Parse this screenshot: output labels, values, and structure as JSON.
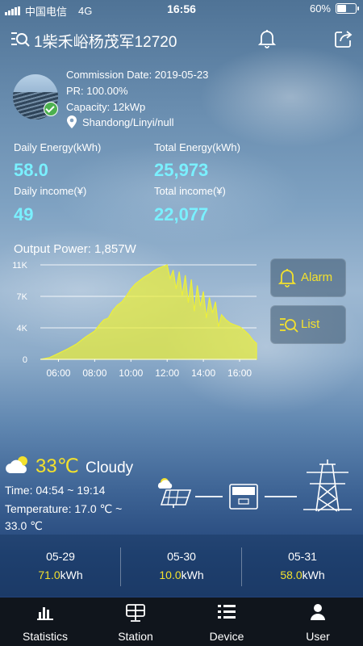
{
  "status_bar": {
    "carrier": "中国电信",
    "network": "4G",
    "time": "16:56",
    "battery_text": "60%",
    "battery_level": 0.6
  },
  "header": {
    "title": "1柴禾峪杨茂军12720",
    "station_icon": "station-search-icon",
    "bell_icon": "bell-icon",
    "share_icon": "share-icon"
  },
  "station": {
    "commission": "Commission Date: 2019-05-23",
    "pr": "PR: 100.00%",
    "capacity": "Capacity: 12kWp",
    "location": "Shandong/Linyi/null"
  },
  "stats": {
    "daily_energy_label": "Daily Energy(kWh)",
    "daily_energy_value": "58.0",
    "total_energy_label": "Total Energy(kWh)",
    "total_energy_value": "25,973",
    "daily_income_label": "Daily income(¥)",
    "daily_income_value": "49",
    "total_income_label": "Total income(¥)",
    "total_income_value": "22,077"
  },
  "chart_title": "Output Power: 1,857W",
  "chart_data": {
    "type": "area",
    "title": "Output Power: 1,857W",
    "xlabel": "",
    "ylabel": "",
    "x_tick_labels": [
      "06:00",
      "08:00",
      "10:00",
      "12:00",
      "14:00",
      "16:00"
    ],
    "y_tick_labels": [
      "0",
      "4K",
      "7K",
      "11K"
    ],
    "xlim": [
      "05:00",
      "16:56"
    ],
    "ylim": [
      0,
      11000
    ],
    "grid": true,
    "fill_color": "#ecef3a",
    "series": [
      {
        "x": [
          "05:00",
          "05:30",
          "06:00",
          "06:30",
          "07:00",
          "07:30",
          "08:00",
          "08:15",
          "08:30",
          "08:45",
          "09:00",
          "09:15",
          "09:30",
          "09:45",
          "10:00",
          "10:15",
          "10:30",
          "10:45",
          "11:00",
          "11:15",
          "11:30",
          "11:45",
          "12:00",
          "12:10",
          "12:20",
          "12:30",
          "12:40",
          "12:50",
          "13:00",
          "13:10",
          "13:20",
          "13:30",
          "13:40",
          "13:50",
          "14:00",
          "14:10",
          "14:20",
          "14:30",
          "14:40",
          "14:50",
          "15:00",
          "15:15",
          "15:30",
          "15:45",
          "16:00",
          "16:15",
          "16:30",
          "16:45",
          "16:56"
        ],
        "values": [
          0,
          200,
          700,
          1200,
          1800,
          2600,
          3300,
          4000,
          4600,
          4800,
          5700,
          6300,
          6700,
          7400,
          8200,
          8800,
          9200,
          9600,
          9900,
          10300,
          10600,
          10800,
          11000,
          9400,
          10400,
          8200,
          10200,
          7400,
          9800,
          6600,
          9300,
          5600,
          8600,
          6200,
          7900,
          4800,
          7200,
          5400,
          6700,
          3800,
          5200,
          4600,
          4200,
          4000,
          3800,
          3400,
          2900,
          2200,
          1857
        ]
      }
    ]
  },
  "side_buttons": {
    "alarm": "Alarm",
    "list": "List"
  },
  "weather": {
    "temperature": "33℃",
    "condition": "Cloudy",
    "time_range": "Time: 04:54 ~ 19:14",
    "temp_line1": "Temperature: 17.0 ℃ ~",
    "temp_line2": "33.0 ℃",
    "icon": "partly-cloudy-icon"
  },
  "energy_flow": {
    "solar_icon": "solar-panel-icon",
    "inverter_icon": "inverter-icon",
    "grid_icon": "power-tower-icon"
  },
  "daily_history": [
    {
      "date": "05-29",
      "value": "71.0",
      "unit": "kWh"
    },
    {
      "date": "05-30",
      "value": "10.0",
      "unit": "kWh"
    },
    {
      "date": "05-31",
      "value": "58.0",
      "unit": "kWh"
    }
  ],
  "tabs": [
    {
      "label": "Statistics",
      "icon": "bar-chart-icon"
    },
    {
      "label": "Station",
      "icon": "solar-station-icon"
    },
    {
      "label": "Device",
      "icon": "device-list-icon"
    },
    {
      "label": "User",
      "icon": "user-icon"
    }
  ]
}
